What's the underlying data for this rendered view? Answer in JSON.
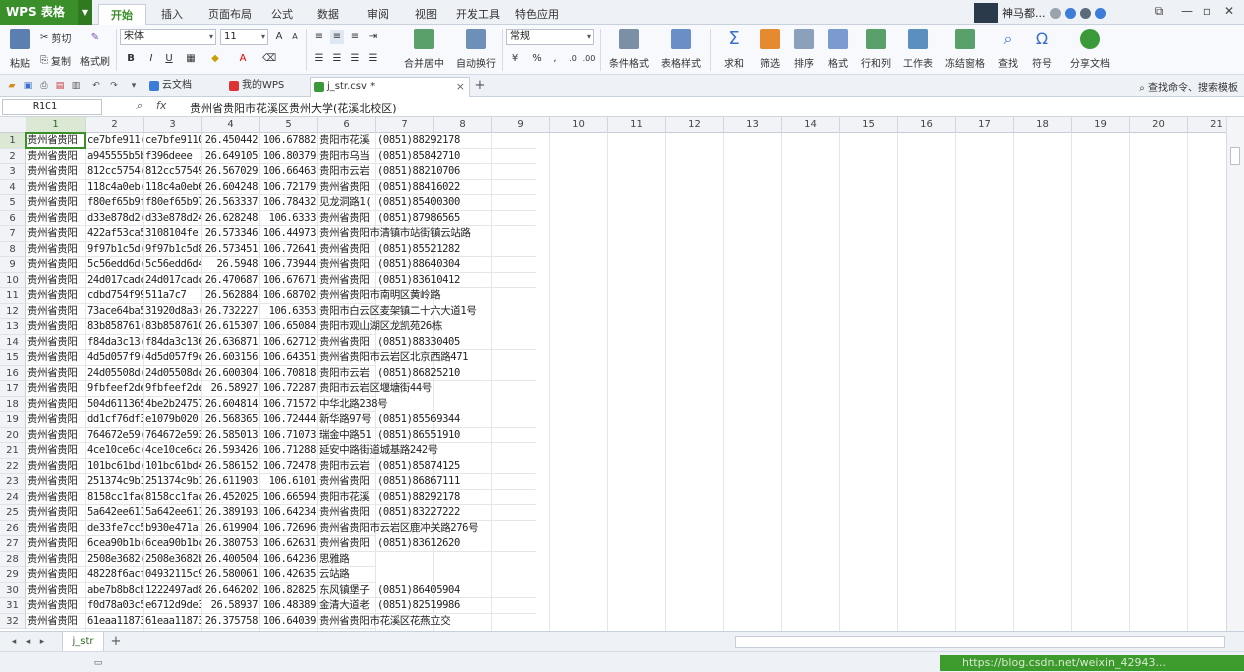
{
  "app": {
    "name": "WPS 表格"
  },
  "menu_tabs": [
    "开始",
    "插入",
    "页面布局",
    "公式",
    "数据",
    "审阅",
    "视图",
    "开发工具",
    "特色应用"
  ],
  "user": {
    "name": "神马都..."
  },
  "ribbon": {
    "paste": "粘贴",
    "cut": "剪切",
    "copy": "复制",
    "format_painter": "格式刷",
    "font_name": "宋体",
    "font_size": "11",
    "number_format": "常规",
    "merge_center": "合并居中",
    "wrap_text": "自动换行",
    "conditional_format": "条件格式",
    "table_style": "表格样式",
    "sum": "求和",
    "filter": "筛选",
    "sort": "排序",
    "format": "格式",
    "row_col": "行和列",
    "worksheet": "工作表",
    "freeze": "冻结窗格",
    "find": "查找",
    "symbol": "符号",
    "share": "分享文档"
  },
  "doc_tabs": [
    {
      "label": "云文档"
    },
    {
      "label": "我的WPS"
    },
    {
      "label": "j_str.csv *"
    }
  ],
  "find_command": "查找命令、搜索模板",
  "formula_bar": {
    "name_box": "R1C1",
    "fx": "fx",
    "content": "贵州省贵阳市花溪区贵州大学(花溪北校区)"
  },
  "columns": [
    "1",
    "2",
    "3",
    "4",
    "5",
    "6",
    "7",
    "8",
    "9",
    "10",
    "11",
    "12",
    "13",
    "14",
    "15",
    "16",
    "17",
    "18",
    "19",
    "20",
    "21"
  ],
  "rows": [
    [
      "贵州省贵阳",
      "ce7bfe911(",
      "ce7bfe9110",
      "26.450442",
      "106.67882",
      "贵阳市花溪",
      "(0851)88292178"
    ],
    [
      "贵州省贵阳",
      "a945555b5b2f",
      "f396deee",
      "26.649105",
      "106.80379",
      "贵阳市乌当",
      "(0851)85842710"
    ],
    [
      "贵州省贵阳",
      "812cc5754(",
      "812cc57549",
      "26.567029",
      "106.66463",
      "贵阳市云岩",
      "(0851)88210706"
    ],
    [
      "贵州省贵阳",
      "118c4a0eb(",
      "118c4a0eb6",
      "26.604248",
      "106.72179",
      "贵州省贵阳",
      "(0851)88416022"
    ],
    [
      "贵州省贵阳",
      "f80ef65b9f",
      "f80ef65b97",
      "26.563337",
      "106.78432",
      "见龙洞路1(",
      "(0851)85400300"
    ],
    [
      "贵州省贵阳",
      "d33e878d2(",
      "d33e878d24",
      "26.628248",
      "106.6333",
      "贵州省贵阳",
      "(0851)87986565"
    ],
    [
      "贵州省贵阳",
      "422af53ca5b",
      "3108104fe",
      "26.573346",
      "106.44973",
      "贵州省贵阳市清镇市站街镇云站路",
      ""
    ],
    [
      "贵州省贵阳",
      "9f97b1c5d(",
      "9f97b1c5d8",
      "26.573451",
      "106.72641",
      "贵州省贵阳",
      "(0851)85521282"
    ],
    [
      "贵州省贵阳",
      "5c56edd6d(",
      "5c56edd6d4",
      "26.5948",
      "106.73944",
      "贵州省贵阳",
      "(0851)88640304"
    ],
    [
      "贵州省贵阳",
      "24d017cadc",
      "24d017cadc",
      "26.470687",
      "106.67671",
      "贵州省贵阳",
      "(0851)83610412"
    ],
    [
      "贵州省贵阳",
      "cdbd754f9918e",
      "511a7c7",
      "26.562884",
      "106.68702",
      "贵州省贵阳市南明区黄岭路",
      ""
    ],
    [
      "贵州省贵阳",
      "73ace64ba5",
      "31920d8a3(",
      "26.732227",
      "106.6353",
      "贵阳市白云区麦架镇二十六大道1号",
      ""
    ],
    [
      "贵州省贵阳",
      "83b858761(",
      "83b8587610",
      "26.615307",
      "106.65084",
      "贵阳市观山湖区龙凯苑26栋",
      ""
    ],
    [
      "贵州省贵阳",
      "f84da3c13(",
      "f84da3c136",
      "26.636871",
      "106.62712",
      "贵州省贵阳",
      "(0851)88330405"
    ],
    [
      "贵州省贵阳",
      "4d5d057f9(",
      "4d5d057f9c",
      "26.603156",
      "106.64351",
      "贵州省贵阳市云岩区北京西路471",
      ""
    ],
    [
      "贵州省贵阳",
      "24d05508d(",
      "24d05508dc",
      "26.600304",
      "106.70818",
      "贵阳市云岩",
      "(0851)86825210"
    ],
    [
      "贵州省贵阳",
      "9fbfeef2de",
      "9fbfeef2de",
      "26.58927",
      "106.72287",
      "贵阳市云岩区堰塘街44号",
      ""
    ],
    [
      "贵州省贵阳",
      "504d611365",
      "4be2b24757",
      "26.604814",
      "106.71572",
      "中华北路238号",
      ""
    ],
    [
      "贵州省贵阳",
      "dd1cf76df3f",
      "e1079b020",
      "26.568365",
      "106.72444",
      "新华路97号",
      "(0851)85569344"
    ],
    [
      "贵州省贵阳",
      "764672e59(",
      "764672e593",
      "26.585013",
      "106.71073",
      "瑞金中路51",
      "(0851)86551910"
    ],
    [
      "贵州省贵阳",
      "4ce10ce6c(",
      "4ce10ce6ca",
      "26.593426",
      "106.71288",
      "延安中路街道城基路242号",
      ""
    ],
    [
      "贵州省贵阳",
      "101bc61bd(",
      "101bc61bd4",
      "26.586152",
      "106.72478",
      "贵阳市云岩",
      "(0851)85874125"
    ],
    [
      "贵州省贵阳",
      "251374c9b1",
      "251374c9b1",
      "26.611903",
      "106.6101",
      "贵州省贵阳",
      "(0851)86867111"
    ],
    [
      "贵州省贵阳",
      "8158cc1fac",
      "8158cc1fac",
      "26.452025",
      "106.66594",
      "贵阳市花溪",
      "(0851)88292178"
    ],
    [
      "贵州省贵阳",
      "5a642ee611",
      "5a642ee611",
      "26.389193",
      "106.64234",
      "贵州省贵阳",
      "(0851)83227222"
    ],
    [
      "贵州省贵阳",
      "de33fe7cc5f",
      "b930e471a",
      "26.619904",
      "106.72696",
      "贵州省贵阳市云岩区鹿冲关路276号",
      ""
    ],
    [
      "贵州省贵阳",
      "6cea90b1b(",
      "6cea90b1bc",
      "26.380753",
      "106.62631",
      "贵州省贵阳",
      "(0851)83612620"
    ],
    [
      "贵州省贵阳",
      "2508e3682(",
      "2508e3682b",
      "26.400504",
      "106.64236",
      "思雅路",
      ""
    ],
    [
      "贵州省贵阳",
      "48228f6acf",
      "04932115c9",
      "26.580061",
      "106.42635",
      "云站路",
      ""
    ],
    [
      "贵州省贵阳",
      "abe7b8b8cb",
      "1222497ad8",
      "26.646202",
      "106.82825",
      "东风镇堡子",
      "(0851)86405904"
    ],
    [
      "贵州省贵阳",
      "f0d78a03c5",
      "e6712d9de3",
      "26.58937",
      "106.48389",
      "金清大道老",
      "(0851)82519986"
    ],
    [
      "贵州省贵阳",
      "61eaa11873",
      "61eaa11873",
      "26.375758",
      "106.64039",
      "贵州省贵阳市花溪区花燕立交",
      ""
    ]
  ],
  "sheet_tab": "j_str",
  "watermark": "https://blog.csdn.net/weixin_42943..."
}
